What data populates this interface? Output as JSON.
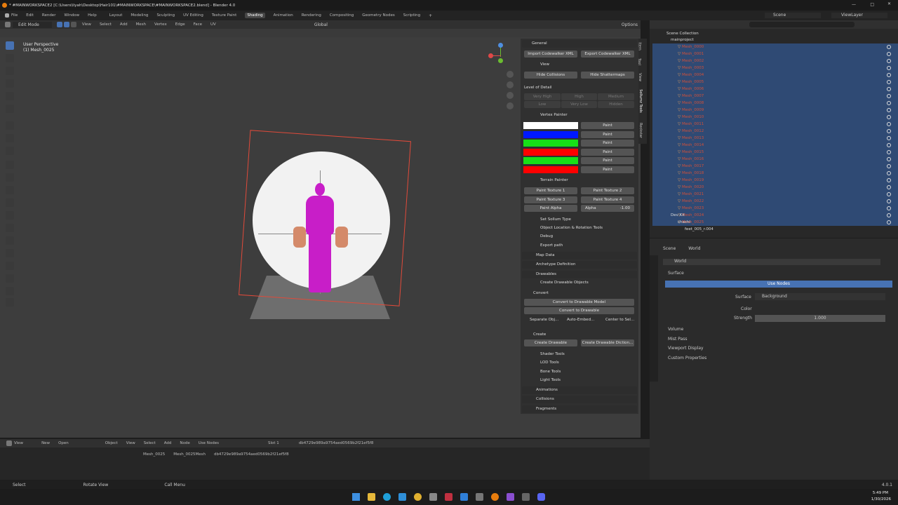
{
  "window": {
    "title": "* #MAINWORKSPACE2 [C:\\Users\\liyah\\Desktop\\Hair101\\#MAINWORKSPACE\\#MAINWORKSPACE2.blend] - Blender 4.0"
  },
  "menu": [
    "File",
    "Edit",
    "Render",
    "Window",
    "Help"
  ],
  "workspaces": [
    "Layout",
    "Modeling",
    "Sculpting",
    "UV Editing",
    "Texture Paint",
    "Shading",
    "Animation",
    "Rendering",
    "Compositing",
    "Geometry Nodes",
    "Scripting"
  ],
  "active_workspace": "Shading",
  "scene": "Scene",
  "view_layer": "ViewLayer",
  "viewport": {
    "mode": "Edit Mode",
    "menu": [
      "View",
      "Select",
      "Add",
      "Mesh",
      "Vertex",
      "Edge",
      "Face",
      "UV"
    ],
    "transform": "Global",
    "options": "Options",
    "info_line1": "User Perspective",
    "info_line2": "(1) Mesh_0025"
  },
  "sidetabs": [
    "Item",
    "Tool",
    "View",
    "Sollumz Tools",
    "Rockstar"
  ],
  "panel": {
    "general": "General",
    "import_xml": "Import Codewalker XML",
    "export_xml": "Export Codewalker XML",
    "view": "View",
    "hide_collisions": "Hide Collisions",
    "hide_shattermaps": "Hide Shattermaps",
    "lod_label": "Level of Detail",
    "lod": [
      "Very High",
      "High",
      "Medium",
      "Low",
      "Very Low",
      "Hidden"
    ],
    "vertex_painter": "Vertex Painter",
    "paint": "Paint",
    "swatches": [
      "#ffffff",
      "#0018ff",
      "#17e017",
      "#ff0000",
      "#17e017",
      "#ff0000"
    ],
    "terrain_painter": "Terrain Painter",
    "pt1": "Paint Texture 1",
    "pt2": "Paint Texture 2",
    "pt3": "Paint Texture 3",
    "pt4": "Paint Texture 4",
    "paint_alpha": "Paint Alpha",
    "alpha_label": "Alpha",
    "alpha_value": "-1.00",
    "set_sollum": "Set Sollum Type",
    "obj_loc": "Object Location & Rotation Tools",
    "debug": "Debug",
    "export_path": "Export path",
    "map_data": "Map Data",
    "archetype": "Archetype Definition",
    "drawables": "Drawables",
    "create_drawable_objects": "Create Drawable Objects",
    "convert": "Convert",
    "convert_model": "Convert to Drawable Model",
    "convert_drawable": "Convert to Drawable",
    "separate": "Separate Obj...",
    "auto_embed": "Auto-Embed...",
    "center_to": "Center to Sel...",
    "create": "Create",
    "create_drawable": "Create Drawable",
    "create_dict": "Create Drawable Diction...",
    "shader_tools": "Shader Tools",
    "lod_tools": "LOD Tools",
    "bone_tools": "Bone Tools",
    "light_tools": "Light Tools",
    "animations": "Animations",
    "collisions": "Collisions",
    "fragments": "Fragments"
  },
  "outliner": {
    "root": "Scene Collection",
    "collection": "mainproject",
    "meshes": [
      "Mesh_0000",
      "Mesh_0001",
      "Mesh_0002",
      "Mesh_0003",
      "Mesh_0004",
      "Mesh_0005",
      "Mesh_0006",
      "Mesh_0007",
      "Mesh_0008",
      "Mesh_0009",
      "Mesh_0010",
      "Mesh_0011",
      "Mesh_0012",
      "Mesh_0013",
      "Mesh_0014",
      "Mesh_0015",
      "Mesh_0016",
      "Mesh_0017",
      "Mesh_0018",
      "Mesh_0019",
      "Mesh_0020",
      "Mesh_0021",
      "Mesh_0022",
      "Mesh_0023",
      "Mesh_0024",
      "Mesh_0025"
    ],
    "devkit": "Dev Kit",
    "chachi": "chachi",
    "feet": "feet_005_r.004"
  },
  "properties": {
    "scene": "Scene",
    "world_crumb": "World",
    "world_field": "World",
    "surface": "Surface",
    "use_nodes": "Use Nodes",
    "surface_label": "Surface",
    "surface_value": "Background",
    "color_label": "Color",
    "strength_label": "Strength",
    "strength_value": "1.000",
    "volume": "Volume",
    "mist": "Mist Pass",
    "viewport_display": "Viewport Display",
    "custom_props": "Custom Properties"
  },
  "shader_editor": {
    "menu": [
      "View"
    ],
    "new": "New",
    "open": "Open",
    "object": "Object",
    "items": [
      "View",
      "Select",
      "Add",
      "Node"
    ],
    "use_nodes": "Use Nodes",
    "slot": "Slot 1",
    "material": "db4729e989a9754aed0569b2f21ef5f8",
    "crumb_obj": "Mesh_0025",
    "crumb_mesh": "Mesh_0025Mesh",
    "crumb_mat": "db4729e989a9754aed0569b2f21ef5f8"
  },
  "status": {
    "select": "Select",
    "rotate": "Rotate View",
    "call_menu": "Call Menu",
    "version": "4.0.1"
  },
  "taskbar": {
    "time": "5:49 PM",
    "date": "1/30/2026"
  }
}
